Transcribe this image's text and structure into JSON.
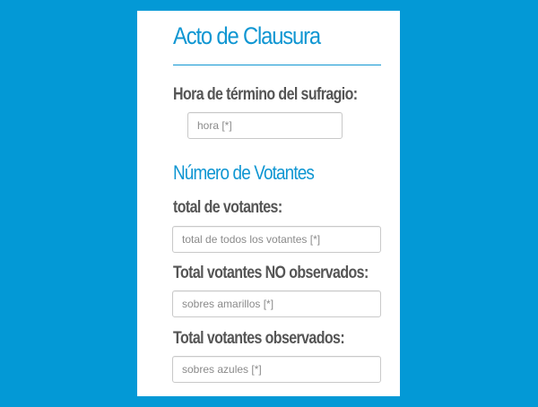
{
  "form": {
    "title": "Acto de Clausura",
    "end_time": {
      "label": "Hora de término del sufragio:",
      "placeholder": "hora [*]",
      "value": ""
    },
    "voters_section": {
      "title": "Número de Votantes",
      "total": {
        "label": "total de votantes:",
        "placeholder": "total de todos los votantes [*]",
        "value": ""
      },
      "not_observed": {
        "label": "Total votantes NO observados:",
        "placeholder": "sobres amarillos [*]",
        "value": ""
      },
      "observed": {
        "label": "Total votantes observados:",
        "placeholder": "sobres azules [*]",
        "value": ""
      }
    }
  },
  "colors": {
    "background": "#0399d6",
    "accent": "#0f96d2",
    "label_text": "#555555",
    "panel": "#ffffff"
  }
}
